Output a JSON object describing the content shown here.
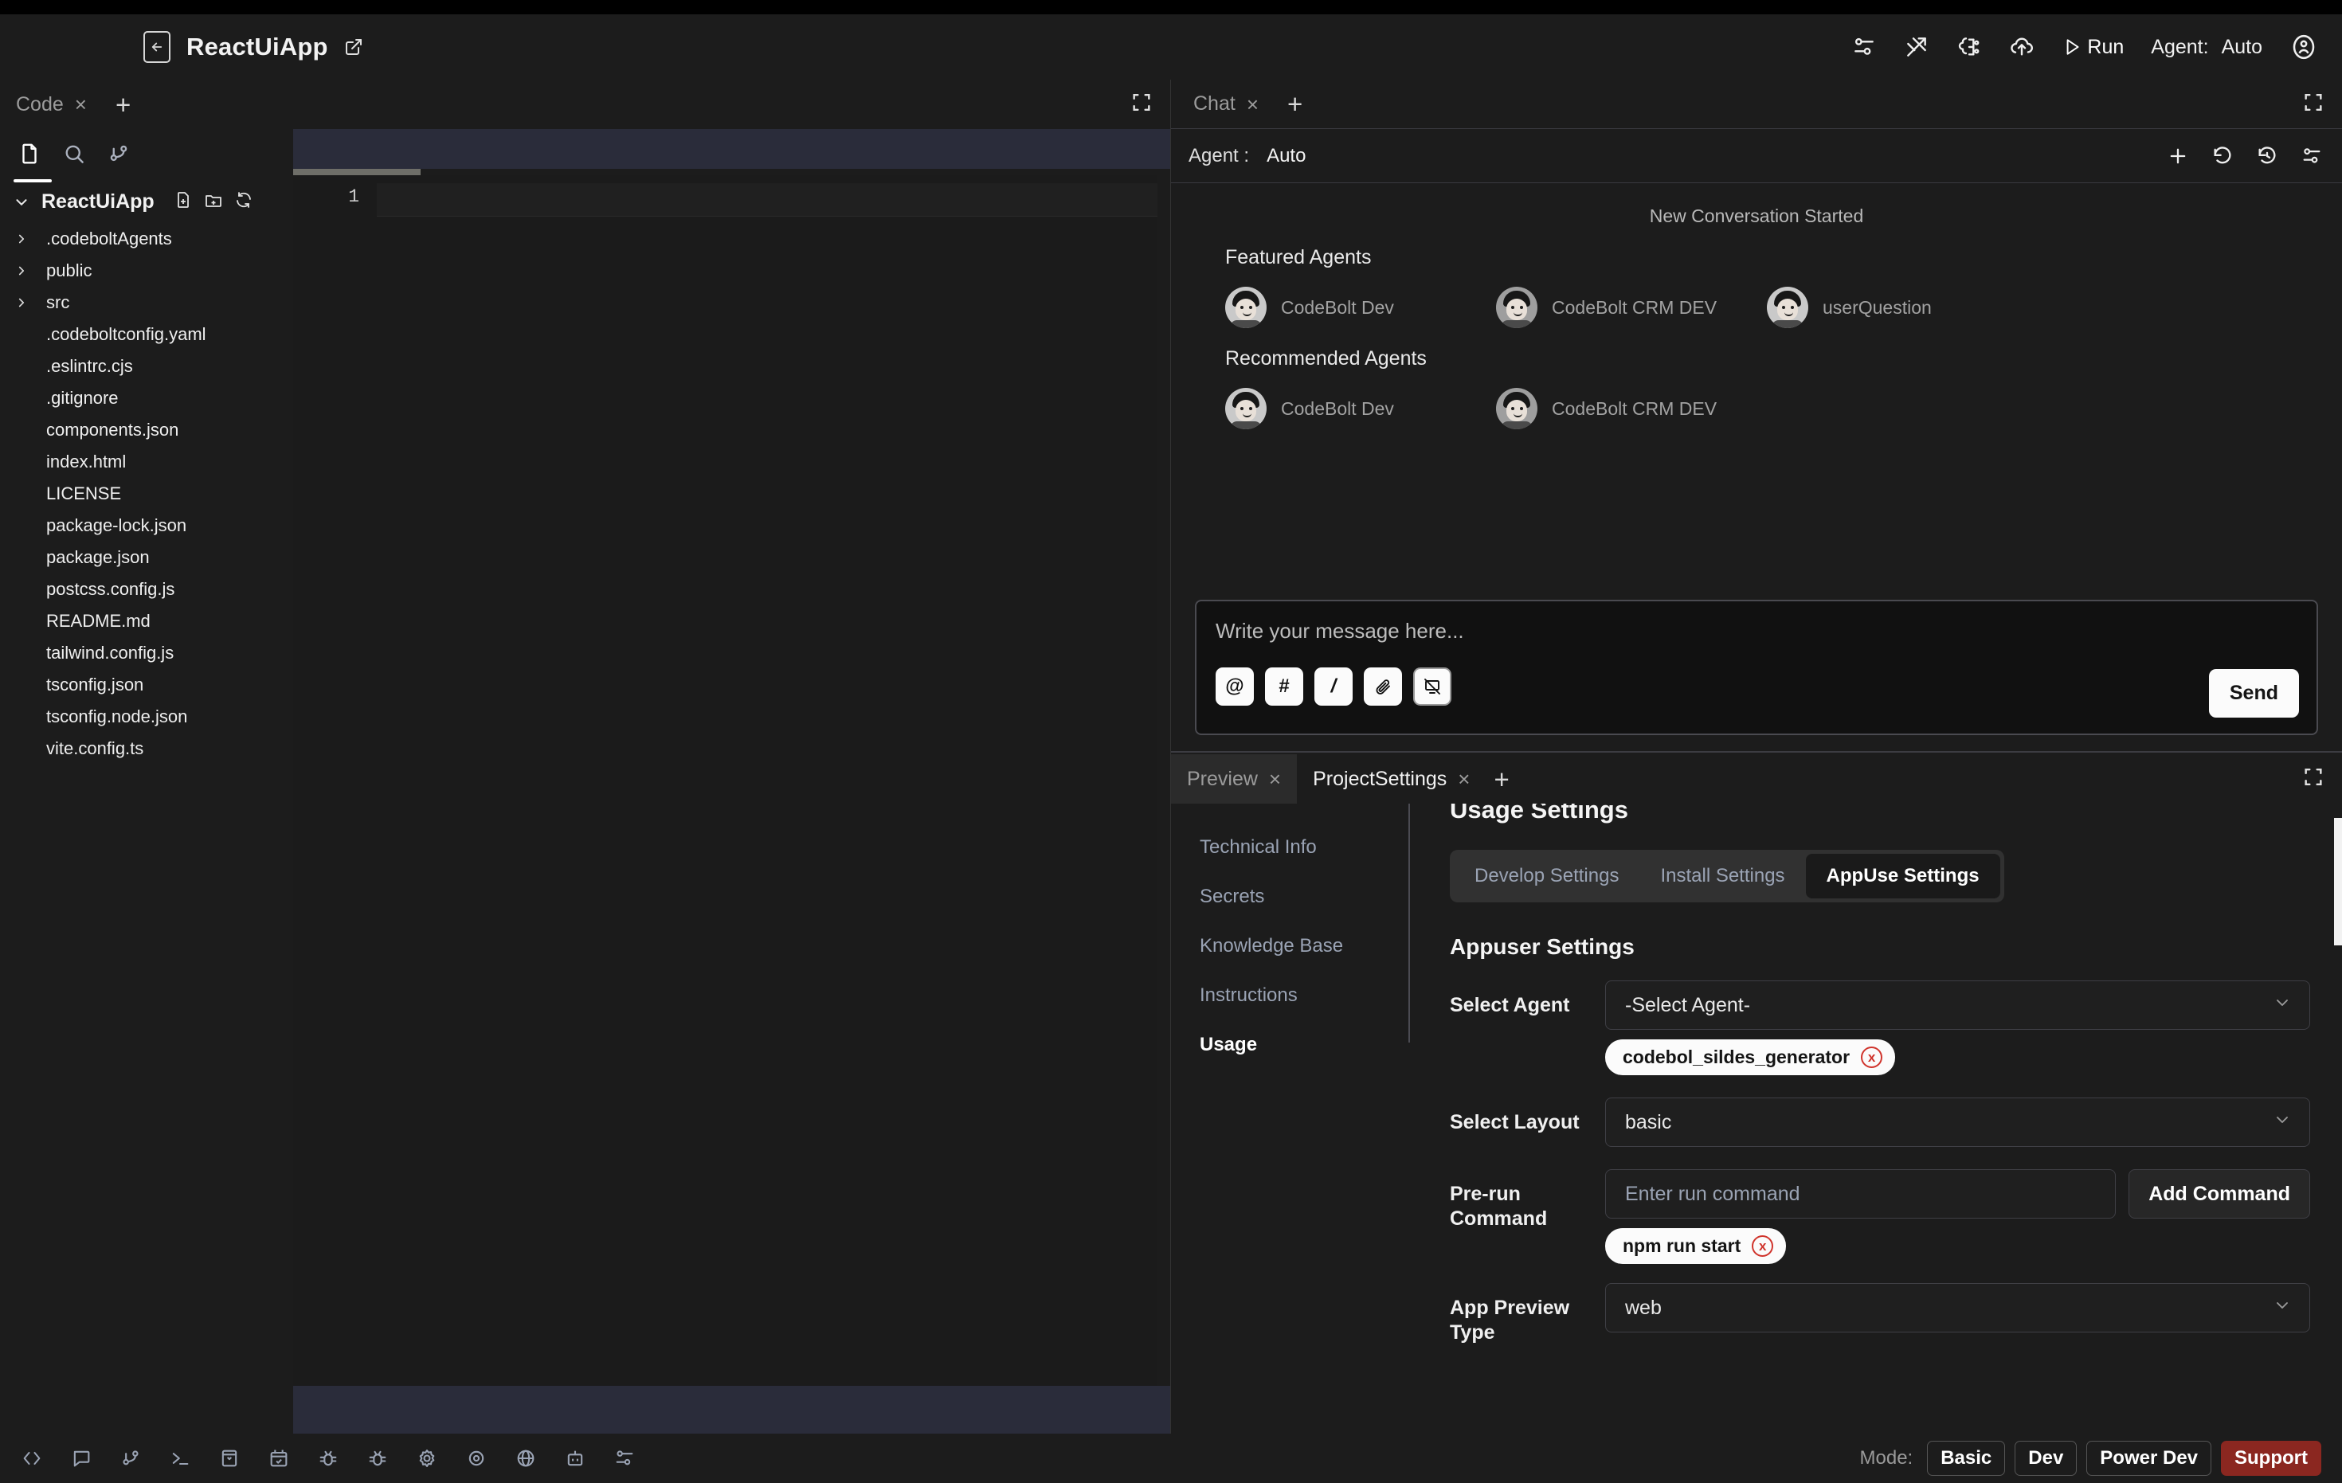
{
  "titlebar": {
    "project_title": "ReactUiApp",
    "back_icon": "back-arrow-icon",
    "external_link_icon": "external-link-icon",
    "icons": [
      "settings-sliders-icon",
      "tools-icon",
      "brain-circuit-icon",
      "cloud-upload-icon"
    ],
    "run_label": "Run",
    "agent_label": "Agent:",
    "agent_value": "Auto",
    "profile_icon": "user-avatar-icon"
  },
  "code_panel": {
    "tab_label": "Code",
    "tab_close": "×",
    "tab_add": "+",
    "expand_icon": "expand-icon",
    "activity_icons": [
      "file-explorer-icon",
      "search-icon",
      "source-control-icon"
    ],
    "tree": {
      "root": "ReactUiApp",
      "new_file_icon": "new-file-icon",
      "new_folder_icon": "new-folder-icon",
      "refresh_icon": "refresh-icon",
      "items": [
        {
          "name": ".codeboltAgents",
          "folder": true
        },
        {
          "name": "public",
          "folder": true
        },
        {
          "name": "src",
          "folder": true
        },
        {
          "name": ".codeboltconfig.yaml",
          "folder": false
        },
        {
          "name": ".eslintrc.cjs",
          "folder": false
        },
        {
          "name": ".gitignore",
          "folder": false
        },
        {
          "name": "components.json",
          "folder": false
        },
        {
          "name": "index.html",
          "folder": false
        },
        {
          "name": "LICENSE",
          "folder": false
        },
        {
          "name": "package-lock.json",
          "folder": false
        },
        {
          "name": "package.json",
          "folder": false
        },
        {
          "name": "postcss.config.js",
          "folder": false
        },
        {
          "name": "README.md",
          "folder": false
        },
        {
          "name": "tailwind.config.js",
          "folder": false
        },
        {
          "name": "tsconfig.json",
          "folder": false
        },
        {
          "name": "tsconfig.node.json",
          "folder": false
        },
        {
          "name": "vite.config.ts",
          "folder": false
        }
      ]
    },
    "editor": {
      "line_number": "1",
      "content": ""
    }
  },
  "chat_panel": {
    "tab_label": "Chat",
    "tab_close": "×",
    "tab_add": "+",
    "expand_icon": "expand-icon",
    "agent_label": "Agent :",
    "agent_value": "Auto",
    "toolbar_icons": [
      "new-chat-icon",
      "reset-icon",
      "history-icon",
      "chat-settings-icon"
    ],
    "new_conversation": "New Conversation Started",
    "featured_heading": "Featured Agents",
    "featured_agents": [
      {
        "name": "CodeBolt Dev"
      },
      {
        "name": "CodeBolt CRM DEV"
      },
      {
        "name": "userQuestion"
      }
    ],
    "recommended_heading": "Recommended Agents",
    "recommended_agents": [
      {
        "name": "CodeBolt Dev"
      },
      {
        "name": "CodeBolt CRM DEV"
      }
    ],
    "input_placeholder": "Write your message here...",
    "tools": [
      {
        "icon": "mention-icon",
        "glyph": "@"
      },
      {
        "icon": "hash-icon",
        "glyph": "#"
      },
      {
        "icon": "slash-command-icon",
        "glyph": "/"
      },
      {
        "icon": "attachment-icon",
        "glyph": "✂"
      },
      {
        "icon": "screenshot-icon",
        "glyph": "▧"
      }
    ],
    "send_label": "Send"
  },
  "settings_panel": {
    "tabs": [
      {
        "label": "Preview",
        "active": false,
        "close": "×"
      },
      {
        "label": "ProjectSettings",
        "active": true,
        "close": "×"
      }
    ],
    "tab_add": "+",
    "expand_icon": "expand-icon",
    "nav_items": [
      {
        "label": "Technical Info",
        "active": false
      },
      {
        "label": "Secrets",
        "active": false
      },
      {
        "label": "Knowledge Base",
        "active": false
      },
      {
        "label": "Instructions",
        "active": false
      },
      {
        "label": "Usage",
        "active": true
      }
    ],
    "usage_title": "Usage Settings",
    "segments": [
      {
        "label": "Develop Settings",
        "active": false
      },
      {
        "label": "Install Settings",
        "active": false
      },
      {
        "label": "AppUse Settings",
        "active": true
      }
    ],
    "section_title": "Appuser Settings",
    "fields": {
      "select_agent": {
        "label": "Select Agent",
        "value": "-Select Agent-",
        "chips": [
          {
            "label": "codebol_sildes_generator",
            "remove": "x"
          }
        ]
      },
      "select_layout": {
        "label": "Select Layout",
        "value": "basic"
      },
      "prerun_command": {
        "label": "Pre-run Command",
        "placeholder": "Enter run command",
        "button": "Add Command",
        "chips": [
          {
            "label": "npm run start",
            "remove": "x"
          }
        ]
      },
      "app_preview_type": {
        "label": "App Preview Type",
        "value": "web"
      }
    }
  },
  "statusbar": {
    "icons": [
      "code-brackets-icon",
      "comment-icon",
      "source-control-icon",
      "terminal-icon",
      "package-icon",
      "calendar-check-icon",
      "debug-bug-icon",
      "bug-icon",
      "gear-icon",
      "eye-icon",
      "globe-icon",
      "robot-icon",
      "sliders-icon"
    ],
    "mode_label": "Mode:",
    "modes": [
      {
        "label": "Basic",
        "variant": "outline"
      },
      {
        "label": "Dev",
        "variant": "outline"
      },
      {
        "label": "Power Dev",
        "variant": "outline"
      },
      {
        "label": "Support",
        "variant": "support"
      }
    ],
    "support_color": "#8b2720"
  }
}
